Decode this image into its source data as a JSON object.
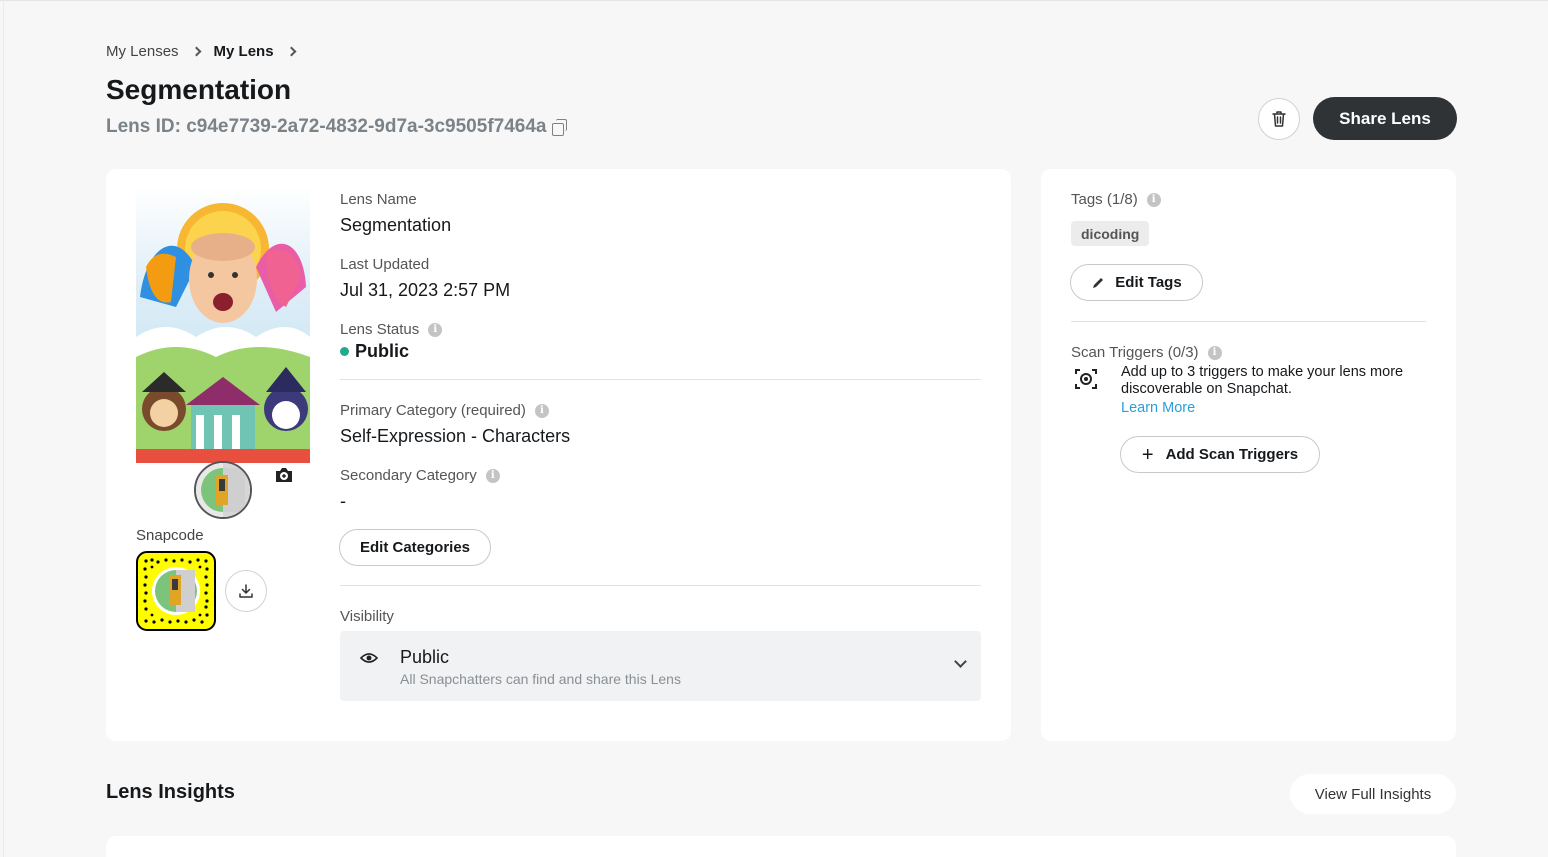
{
  "breadcrumb": {
    "items": [
      "My Lenses",
      "My Lens"
    ]
  },
  "header": {
    "title": "Segmentation",
    "lens_id": "Lens ID: c94e7739-2a72-4832-9d7a-3c9505f7464a",
    "share_label": "Share Lens"
  },
  "details": {
    "lens_name_label": "Lens Name",
    "lens_name": "Segmentation",
    "last_updated_label": "Last Updated",
    "last_updated": "Jul 31, 2023 2:57 PM",
    "status_label": "Lens Status",
    "status": "Public",
    "status_color": "#20a98a",
    "primary_category_label": "Primary Category (required)",
    "primary_category": "Self-Expression - Characters",
    "secondary_category_label": "Secondary Category",
    "secondary_category": "-",
    "edit_categories_label": "Edit Categories",
    "visibility_label": "Visibility",
    "visibility": {
      "selected": "Public",
      "description": "All Snapchatters can find and share this Lens"
    },
    "snapcode_label": "Snapcode"
  },
  "tags": {
    "title": "Tags (1/8)",
    "items": [
      "dicoding"
    ],
    "edit_label": "Edit Tags"
  },
  "scan_triggers": {
    "title": "Scan Triggers (0/3)",
    "description": "Add up to 3 triggers to make your lens more discoverable on Snapchat.",
    "learn_more": "Learn More",
    "add_label": "Add Scan Triggers"
  },
  "insights": {
    "title": "Lens Insights",
    "view_label": "View Full Insights"
  },
  "colors": {
    "primary_dark": "#2f3336",
    "accent_link": "#2a9fd8",
    "snapcode_yellow": "#fffc00"
  }
}
